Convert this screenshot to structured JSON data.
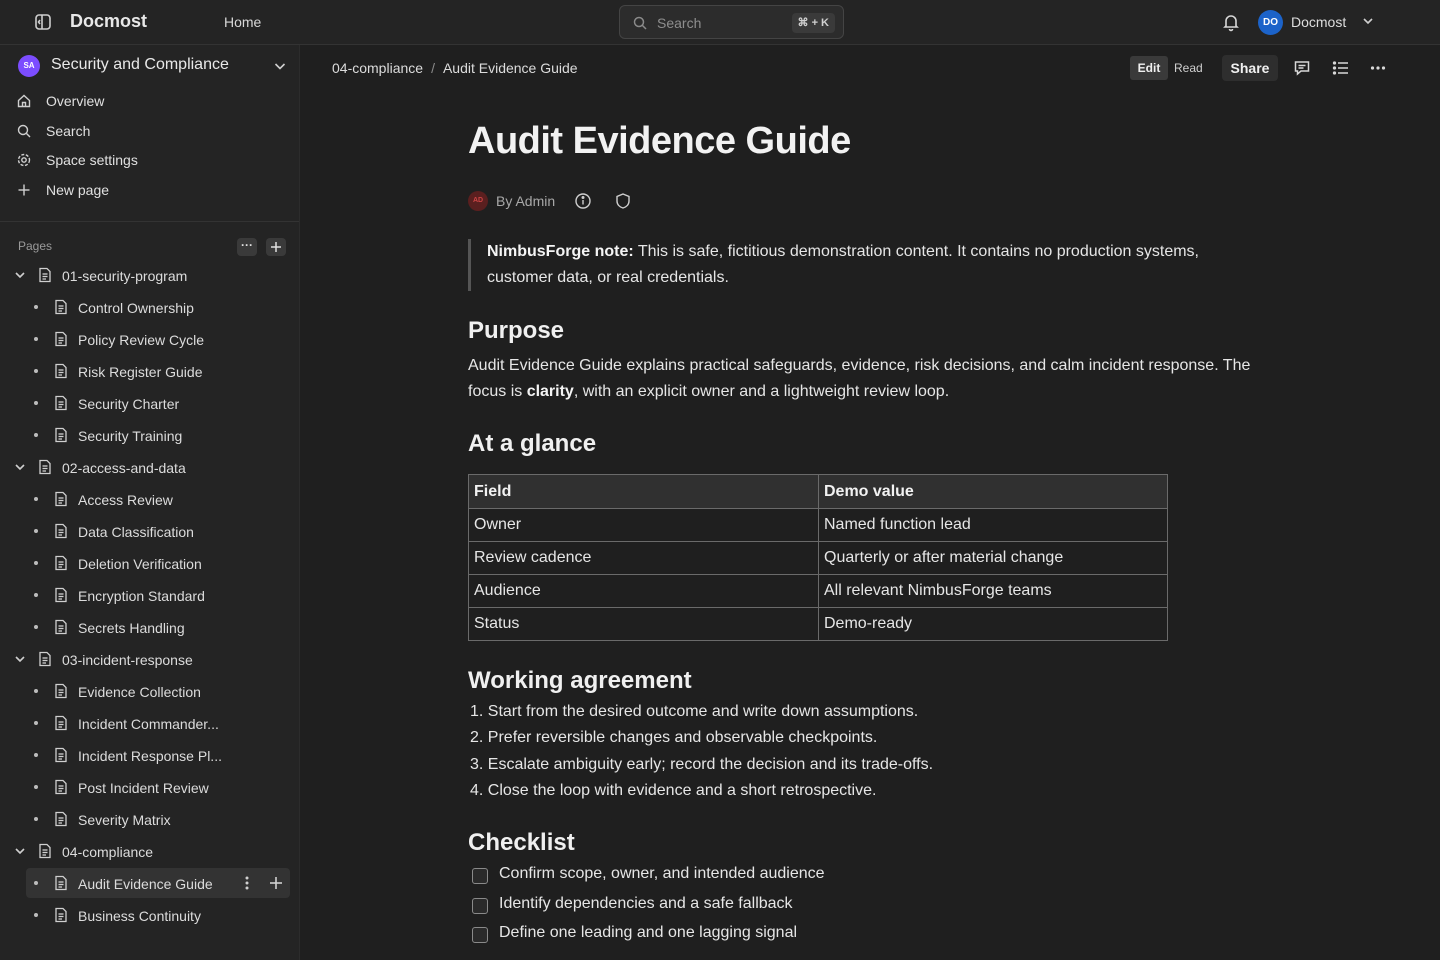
{
  "topbar": {
    "brand": "Docmost",
    "home_label": "Home",
    "search_placeholder": "Search",
    "search_shortcut": "⌘ + K",
    "user_initials": "DO",
    "user_name": "Docmost"
  },
  "sidebar": {
    "space_initials": "SA",
    "space_name": "Security and Compliance",
    "nav": [
      {
        "label": "Overview",
        "icon": "home-icon"
      },
      {
        "label": "Search",
        "icon": "search-icon"
      },
      {
        "label": "Space settings",
        "icon": "gear-icon"
      },
      {
        "label": "New page",
        "icon": "plus-icon"
      }
    ],
    "pages_label": "Pages",
    "pages_more": "···",
    "tree": [
      {
        "label": "01-security-program",
        "level": 0
      },
      {
        "label": "Control Ownership",
        "level": 1
      },
      {
        "label": "Policy Review Cycle",
        "level": 1
      },
      {
        "label": "Risk Register Guide",
        "level": 1
      },
      {
        "label": "Security Charter",
        "level": 1
      },
      {
        "label": "Security Training",
        "level": 1
      },
      {
        "label": "02-access-and-data",
        "level": 0
      },
      {
        "label": "Access Review",
        "level": 1
      },
      {
        "label": "Data Classification",
        "level": 1
      },
      {
        "label": "Deletion Verification",
        "level": 1
      },
      {
        "label": "Encryption Standard",
        "level": 1
      },
      {
        "label": "Secrets Handling",
        "level": 1
      },
      {
        "label": "03-incident-response",
        "level": 0
      },
      {
        "label": "Evidence Collection",
        "level": 1
      },
      {
        "label": "Incident Commander...",
        "level": 1
      },
      {
        "label": "Incident Response Pl...",
        "level": 1
      },
      {
        "label": "Post Incident Review",
        "level": 1
      },
      {
        "label": "Severity Matrix",
        "level": 1
      },
      {
        "label": "04-compliance",
        "level": 0
      },
      {
        "label": "Audit Evidence Guide",
        "level": 1,
        "active": true
      },
      {
        "label": "Business Continuity",
        "level": 1
      }
    ]
  },
  "header": {
    "breadcrumb_parent": "04-compliance",
    "breadcrumb_sep": "/",
    "breadcrumb_current": "Audit Evidence Guide",
    "edit_label": "Edit",
    "read_label": "Read",
    "share_label": "Share"
  },
  "doc": {
    "title": "Audit Evidence Guide",
    "author_initials": "AD",
    "byline": "By Admin",
    "callout_bold": "NimbusForge note:",
    "callout_text": " This is safe, fictitious demonstration content. It contains no production systems, customer data, or real credentials.",
    "purpose_heading": "Purpose",
    "purpose_text_1": "Audit Evidence Guide explains practical safeguards, evidence, risk decisions, and calm incident response. The focus is ",
    "purpose_bold": "clarity",
    "purpose_text_2": ", with an explicit owner and a lightweight review loop.",
    "glance_heading": "At a glance",
    "table": {
      "headers": [
        "Field",
        "Demo value"
      ],
      "rows": [
        [
          "Owner",
          "Named function lead"
        ],
        [
          "Review cadence",
          "Quarterly or after material change"
        ],
        [
          "Audience",
          "All relevant NimbusForge teams"
        ],
        [
          "Status",
          "Demo-ready"
        ]
      ]
    },
    "agreement_heading": "Working agreement",
    "agreement": [
      "1. Start from the desired outcome and write down assumptions.",
      "2. Prefer reversible changes and observable checkpoints.",
      "3. Escalate ambiguity early; record the decision and its trade-offs.",
      "4. Close the loop with evidence and a short retrospective."
    ],
    "checklist_heading": "Checklist",
    "checklist": [
      "Confirm scope, owner, and intended audience",
      "Identify dependencies and a safe fallback",
      "Define one leading and one lagging signal"
    ]
  }
}
